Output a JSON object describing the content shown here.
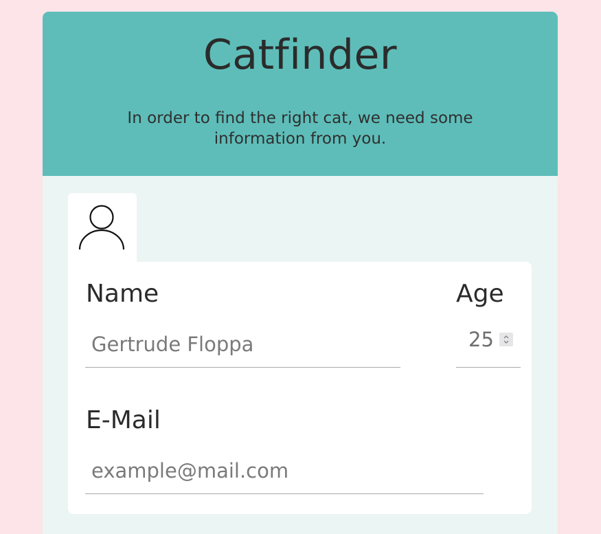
{
  "header": {
    "title": "Catfinder",
    "subtitle": "In order to find the right cat, we need some information from you."
  },
  "profile_tab": {
    "icon": "user-icon"
  },
  "form": {
    "name": {
      "label": "Name",
      "placeholder": "Gertrude Floppa",
      "value": ""
    },
    "age": {
      "label": "Age",
      "value": "25"
    },
    "email": {
      "label": "E-Mail",
      "placeholder": "example@mail.com",
      "value": ""
    }
  },
  "colors": {
    "page_background": "#fce4e8",
    "header_background": "#5ebdb9",
    "body_background": "#ebf5f3",
    "card_background": "#ffffff"
  }
}
